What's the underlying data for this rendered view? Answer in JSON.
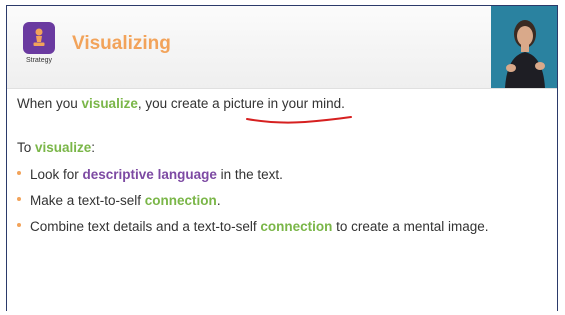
{
  "header": {
    "title": "Visualizing",
    "badge_label": "Strategy"
  },
  "intro": {
    "part1": "When you ",
    "keyword": "visualize",
    "part2": ", you create a picture in your mind."
  },
  "section": {
    "prefix": "To ",
    "keyword": "visualize",
    "suffix": ":"
  },
  "bullets": [
    {
      "pre": "Look for ",
      "keyword": "descriptive language",
      "post": " in the text."
    },
    {
      "pre": "Make a text-to-self ",
      "keyword": "connection",
      "post": "."
    },
    {
      "pre": "Combine text details and a text-to-self ",
      "keyword": "connection",
      "post": " to create a mental image."
    }
  ],
  "colors": {
    "title": "#f2a35a",
    "green_keyword": "#7ab648",
    "purple_keyword": "#7d4aa3",
    "annotation": "#d62020"
  }
}
